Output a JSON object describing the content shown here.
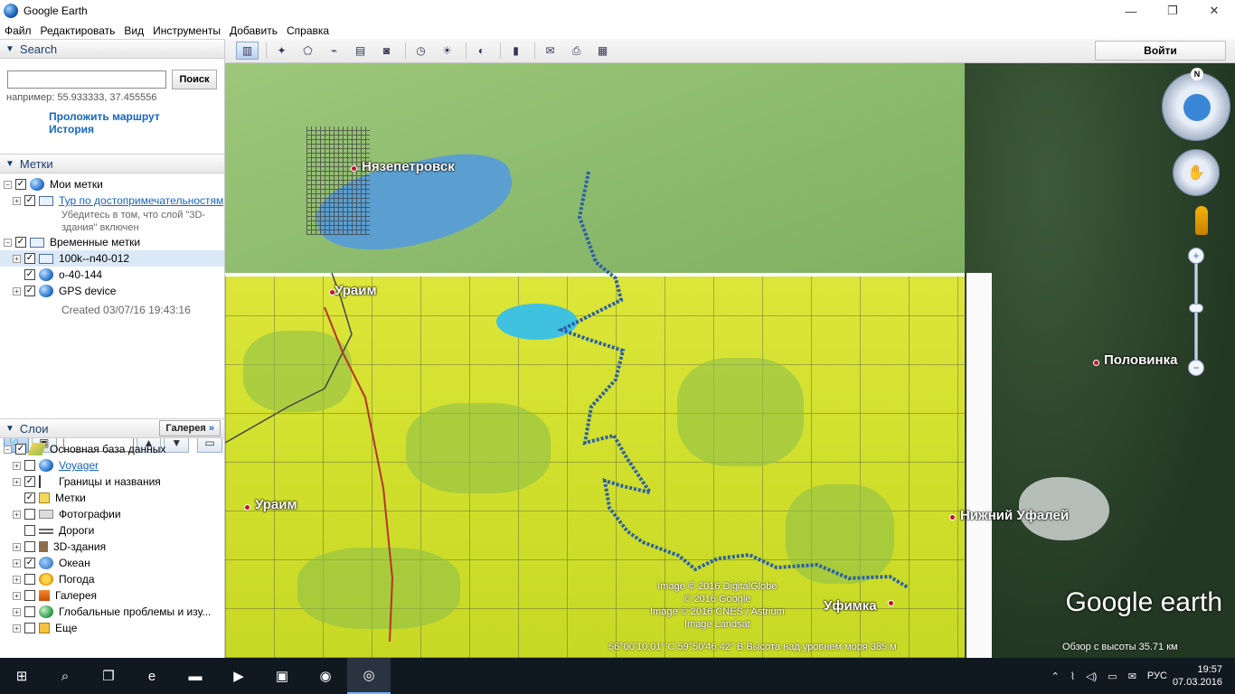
{
  "window": {
    "title": "Google Earth",
    "min": "—",
    "max": "❐",
    "close": "✕"
  },
  "menu": [
    "Файл",
    "Редактировать",
    "Вид",
    "Инструменты",
    "Добавить",
    "Справка"
  ],
  "search": {
    "header": "Search",
    "input_value": "",
    "button": "Поиск",
    "hint": "например: 55.933333, 37.455556",
    "route_link": "Проложить маршрут",
    "history_link": "История"
  },
  "places": {
    "header": "Метки",
    "items": [
      {
        "label": "Мои метки",
        "checked": true,
        "level": 0
      },
      {
        "label": "Тур по достопримечательностям",
        "checked": true,
        "level": 1,
        "link": true,
        "note": "Убедитесь в том, что слой \"3D-здания\" включен"
      },
      {
        "label": "Временные метки",
        "checked": true,
        "level": 0
      },
      {
        "label": "100k--n40-012",
        "checked": true,
        "level": 1,
        "selected": true
      },
      {
        "label": "o-40-144",
        "checked": true,
        "level": 1
      },
      {
        "label": "GPS device",
        "checked": true,
        "level": 1
      }
    ],
    "created": "Created 03/07/16 19:43:16"
  },
  "layers": {
    "header": "Слои",
    "gallery_button": "Галерея",
    "items": [
      {
        "label": "Основная база данных",
        "checked": true,
        "icon": "layers-icon"
      },
      {
        "label": "Voyager",
        "checked": false,
        "icon": "globe-icon",
        "link": true
      },
      {
        "label": "Границы и названия",
        "checked": true,
        "icon": "flag-icon"
      },
      {
        "label": "Метки",
        "checked": true,
        "icon": "tag-icon"
      },
      {
        "label": "Фотографии",
        "checked": false,
        "icon": "camera-icon"
      },
      {
        "label": "Дороги",
        "checked": false,
        "icon": "road-icon"
      },
      {
        "label": "3D-здания",
        "checked": false,
        "icon": "building-icon"
      },
      {
        "label": "Океан",
        "checked": true,
        "icon": "ocean-icon"
      },
      {
        "label": "Погода",
        "checked": false,
        "icon": "sun-icon"
      },
      {
        "label": "Галерея",
        "checked": false,
        "icon": "gallery-icon"
      },
      {
        "label": "Глобальные проблемы и изу...",
        "checked": false,
        "icon": "globe-issues-icon"
      },
      {
        "label": "Еще",
        "checked": false,
        "icon": "more-icon"
      }
    ]
  },
  "toolbar": {
    "login": "Войти"
  },
  "map": {
    "labels": {
      "nyazepetrovsk": "Нязепетровск",
      "uraim1": "Ураим",
      "uraim2": "Ураим",
      "polovinka": "Половинка",
      "nizhny_ufaley": "Нижний Уфалей",
      "ufimka": "Уфимка"
    },
    "copyright": [
      "Image © 2016 DigitalGlobe",
      "© 2016 Google",
      "Image © 2016 CNES / Astrium",
      "Image Landsat"
    ],
    "status": "56°00'10.01\" С  59°50'46.42\" В  Высота над уровнем моря   385 м",
    "eye_alt": "Обзор с высоты   35.71 км",
    "logo": "Google earth",
    "north": "N"
  },
  "taskbar": {
    "lang": "РУС",
    "time": "19:57",
    "date": "07.03.2016"
  }
}
